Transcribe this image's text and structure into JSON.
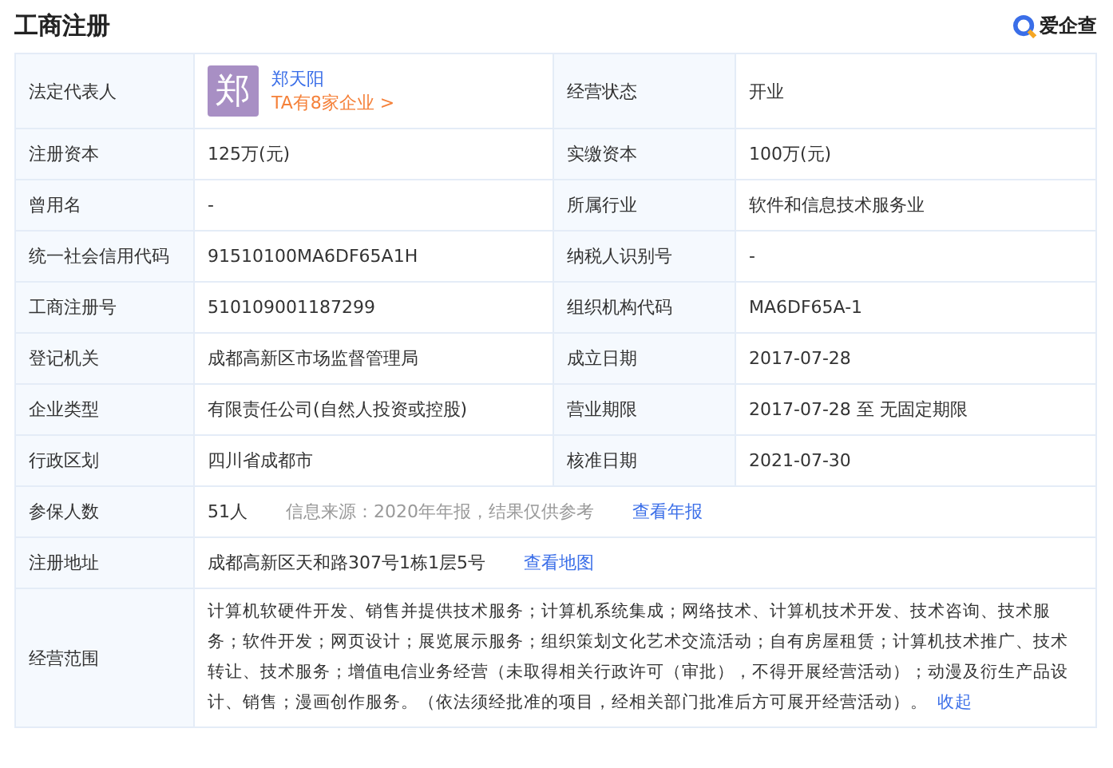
{
  "title": "工商注册",
  "brand": "爱企查",
  "rows": [
    {
      "kind": "representative",
      "label": "法定代表人",
      "avatar": "郑",
      "name": "郑天阳",
      "companies": "TA有8家企业 >",
      "label2": "经营状态",
      "value2": "开业"
    },
    {
      "kind": "pair",
      "label": "注册资本",
      "value": "125万(元)",
      "label2": "实缴资本",
      "value2": "100万(元)"
    },
    {
      "kind": "pair",
      "label": "曾用名",
      "value": "-",
      "label2": "所属行业",
      "value2": "软件和信息技术服务业"
    },
    {
      "kind": "pair",
      "label": "统一社会信用代码",
      "value": "91510100MA6DF65A1H",
      "label2": "纳税人识别号",
      "value2": "-"
    },
    {
      "kind": "pair",
      "label": "工商注册号",
      "value": "510109001187299",
      "label2": "组织机构代码",
      "value2": "MA6DF65A-1"
    },
    {
      "kind": "pair",
      "label": "登记机关",
      "value": "成都高新区市场监督管理局",
      "label2": "成立日期",
      "value2": "2017-07-28"
    },
    {
      "kind": "pair",
      "label": "企业类型",
      "value": "有限责任公司(自然人投资或控股)",
      "label2": "营业期限",
      "value2": "2017-07-28 至 无固定期限"
    },
    {
      "kind": "pair",
      "label": "行政区划",
      "value": "四川省成都市",
      "label2": "核准日期",
      "value2": "2021-07-30"
    },
    {
      "kind": "wide",
      "label": "参保人数",
      "value": "51人",
      "note": "信息来源：2020年年报，结果仅供参考",
      "link": "查看年报"
    },
    {
      "kind": "wide",
      "label": "注册地址",
      "value": "成都高新区天和路307号1栋1层5号",
      "link": "查看地图"
    },
    {
      "kind": "scope",
      "label": "经营范围",
      "value": "计算机软硬件开发、销售并提供技术服务；计算机系统集成；网络技术、计算机技术开发、技术咨询、技术服务；软件开发；网页设计；展览展示服务；组织策划文化艺术交流活动；自有房屋租赁；计算机技术推广、技术转让、技术服务；增值电信业务经营（未取得相关行政许可（审批），不得开展经营活动）；动漫及衍生产品设计、销售；漫画创作服务。（依法须经批准的项目，经相关部门批准后方可展开经营活动）。",
      "link": "收起"
    }
  ]
}
